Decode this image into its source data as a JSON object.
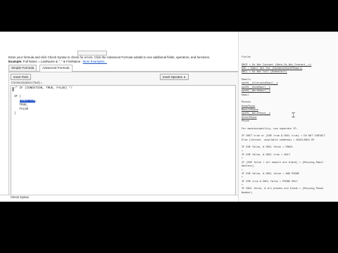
{
  "formula_editor": {
    "truncated_field_label": "",
    "instructions": "Enter your formula and click Check Syntax to check for errors. Click the Advanced Formula subtab to use additional fields, operators, and functions.",
    "example_label": "Example:",
    "example_text": "Full Name = LastName & \", \" & FirstName",
    "example_link": "More Examples...",
    "tabs": [
      "Simple Formula",
      "Advanced Formula"
    ],
    "insert_field": "Insert Field",
    "insert_operator": "Insert Operator",
    "field_caption": "Communication (Text) =",
    "code_lines": [
      "/* IF (CONDITION, TRUE, FALSE) */",
      "",
      "IF (",
      "   CONDITION,",
      "   TRUE,",
      "   FALSE",
      ")"
    ],
    "selected_token": "CONDITION",
    "check_syntax": "Check Syntax"
  },
  "notes_panel": {
    "lines": [
      {
        "t": "Fields",
        "c": "head"
      },
      {
        "t": ""
      },
      {
        "t": "DNCE = Do Not Contact (Note_Do_Not_Contact__c)",
        "c": "ul"
      },
      {
        "t": "EOE = Email Opt Out (HasOptedOutOfEmail)",
        "c": "ul"
      },
      {
        "t": "DNCL = Do Not Call (DoNotCall)",
        "c": "ul"
      },
      {
        "t": ""
      },
      {
        "t": "Emails"
      },
      {
        "t": "npe01__AlternateEmail__c",
        "c": "ul"
      },
      {
        "t": "npe01__HomeEmail__c",
        "c": "ul"
      },
      {
        "t": "npe01__WorkEmail__c",
        "c": "ul"
      },
      {
        "t": "Email"
      },
      {
        "t": ""
      },
      {
        "t": "Phones"
      },
      {
        "t": "HomePhone",
        "c": "ul"
      },
      {
        "t": "MobilePhone",
        "c": "ul"
      },
      {
        "t": "npe01__WorkPhone__c",
        "c": "ul"
      },
      {
        "t": "OtherPhone",
        "c": "ul"
      },
      {
        "t": "Phone"
      },
      {
        "t": ""
      },
      {
        "t": "For maintainability, use separate IF:"
      },
      {
        "t": ""
      },
      {
        "t": "IF DNCT true or (EOE true & DNCL true) = DO NOT CONTACT"
      },
      {
        "t": "Else (Contact  available somehow) = AVAILABLE BY"
      },
      {
        "t": ""
      },
      {
        "t": "IF EOE false, & DNCL false = EMAIL"
      },
      {
        "t": "+"
      },
      {
        "t": "IF EOE false, & DNCL true = ONLY"
      },
      {
        "t": "+"
      },
      {
        "t": "IF (EOE false + all emails are blank) = (Missing Email"
      },
      {
        "t": "Address)"
      },
      {
        "t": "+"
      },
      {
        "t": "IF EOE false, & DNCL false = AND PHONE"
      },
      {
        "t": "+"
      },
      {
        "t": "IF EOE true & DNCL false = PHONE ONLY"
      },
      {
        "t": "+"
      },
      {
        "t": "IF DNCL false, & all phones are blank = (Missing Phone"
      },
      {
        "t": "Number)"
      }
    ]
  },
  "colors": {
    "selection": "#1e4fc6",
    "link": "#1a55c5",
    "letterbox": "#000000"
  }
}
